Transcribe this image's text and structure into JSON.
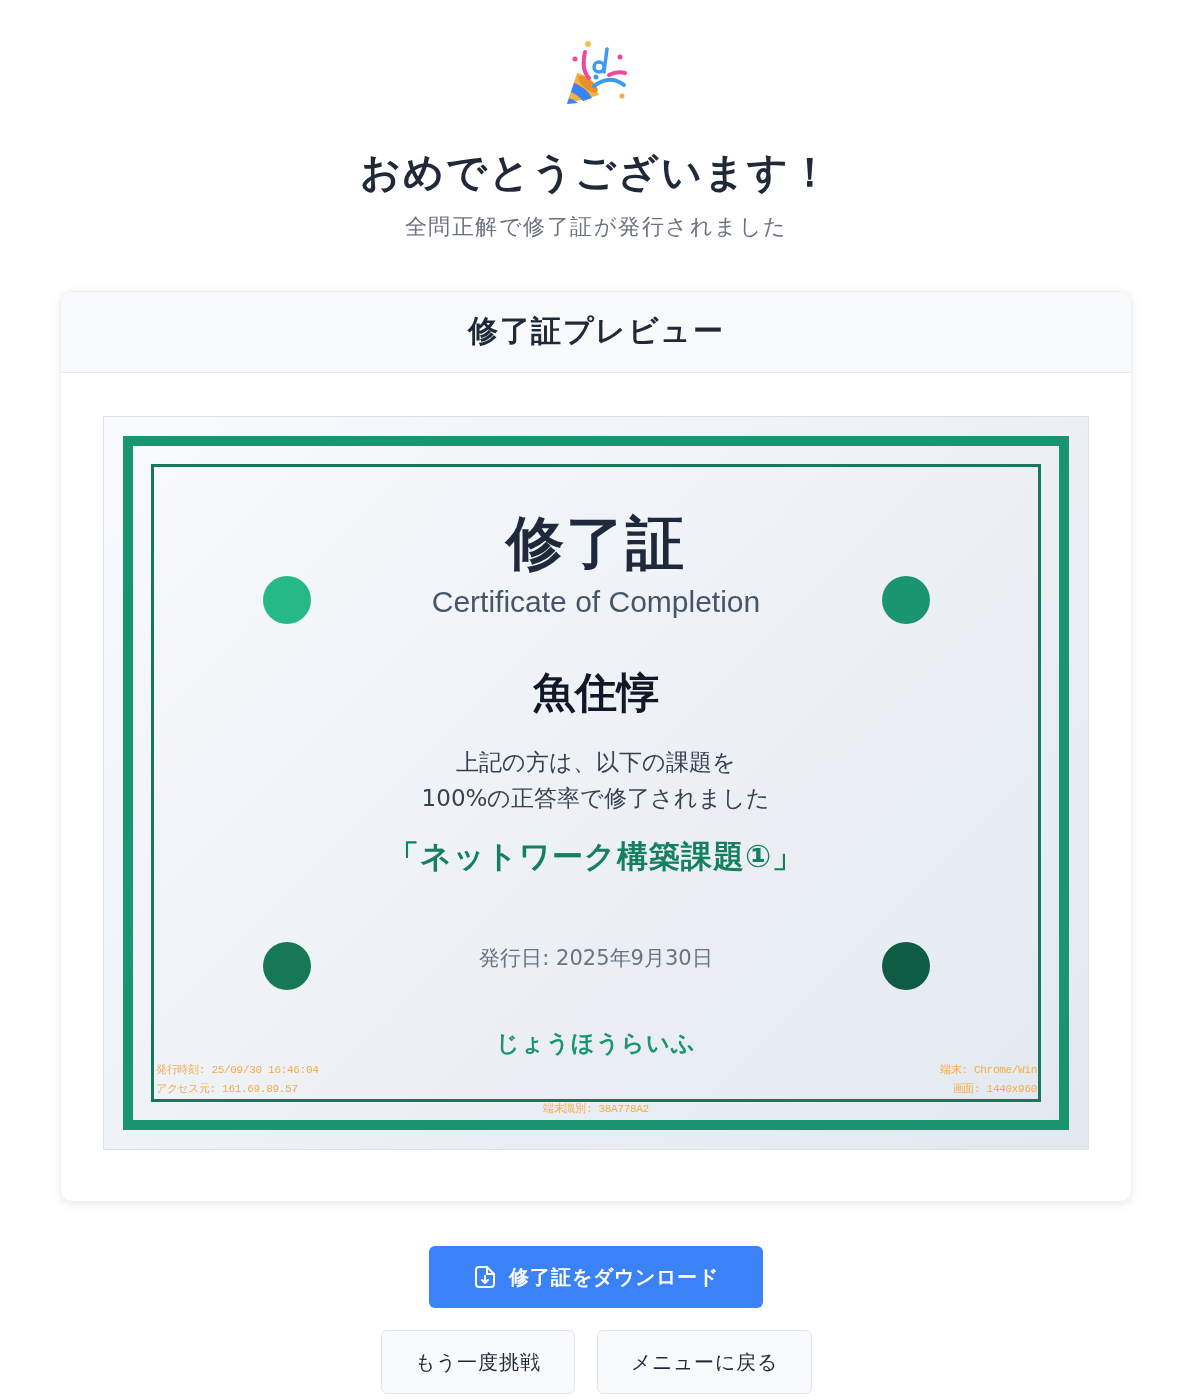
{
  "celebration": {
    "title": "おめでとうございます！",
    "subtitle": "全問正解で修了証が発行されました"
  },
  "preview_card": {
    "title": "修了証プレビュー",
    "certificate": {
      "title": "修了証",
      "subtitle": "Certificate of Completion",
      "recipient": "魚住惇",
      "description_lines": [
        "上記の方は、以下の課題を",
        "100%の正答率で修了されました"
      ],
      "course": "「ネットワーク構築課題①」",
      "issue_date": "発行日: 2025年9月30日",
      "issuer": "じょうほうらいふ",
      "corner_dots": [
        {
          "color": "#26b886"
        },
        {
          "color": "#1b9470"
        },
        {
          "color": "#167856"
        },
        {
          "color": "#0f5c44"
        }
      ],
      "stamp_left": [
        "発行時刻: 25/09/30 16:46:04",
        "アクセス元: 161.69.89.57"
      ],
      "stamp_right": [
        "端末: Chrome/Win",
        "画面: 1440x960"
      ],
      "stamp_bottom": "端末識別: 38A778A2"
    }
  },
  "buttons": [
    {
      "kind": "primary",
      "label": "修了証をダウンロード"
    },
    {
      "kind": "secondary",
      "label": "もう一度挑戦"
    },
    {
      "kind": "secondary",
      "label": "メニューに戻る"
    }
  ]
}
